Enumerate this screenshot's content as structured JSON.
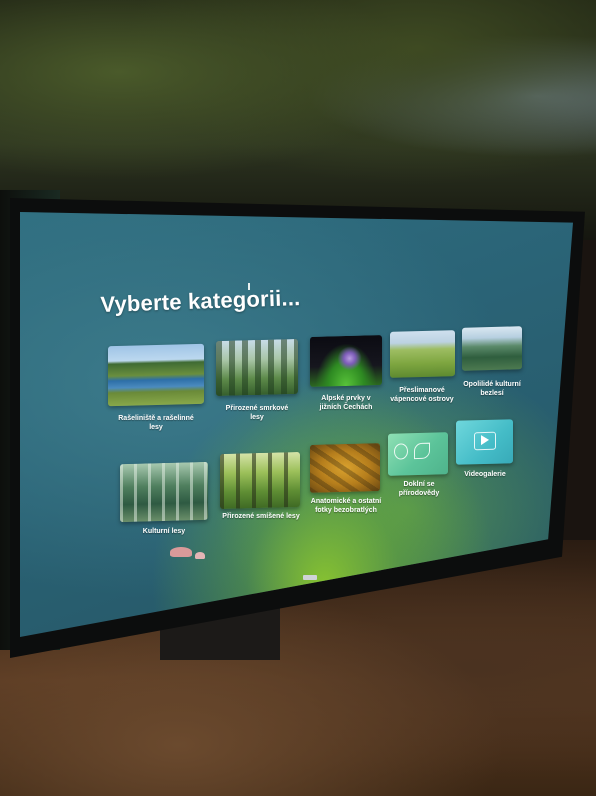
{
  "screen": {
    "title": "Vyberte kategorii...",
    "tiles": [
      {
        "label": "Rašeliniště a rašelinné lesy",
        "image": "bog-landscape"
      },
      {
        "label": "Přirozené smrkové lesy",
        "image": "spruce-forest"
      },
      {
        "label": "Alpské prvky v jižních Čechách",
        "image": "alpine-flower"
      },
      {
        "label": "Přeslimanové vápencové ostrovy",
        "image": "limestone-meadow"
      },
      {
        "label": "Opolilidé kulturní bezlesí",
        "image": "cultural-landscape"
      },
      {
        "label": "Kulturní lesy",
        "image": "cultural-forest"
      },
      {
        "label": "Přirozené smíšené lesy",
        "image": "mixed-forest"
      },
      {
        "label": "Anatomické a ostatní fotky bezobratlých",
        "image": "wood-anatomy"
      },
      {
        "label": "Doklní se přírodovědy",
        "image": "science-icon"
      },
      {
        "label": "Videogalerie",
        "image": "video-gallery-icon"
      }
    ]
  },
  "colors": {
    "screen_bg": "#2a6376",
    "glow": "#96d228",
    "title": "#ffffff"
  }
}
